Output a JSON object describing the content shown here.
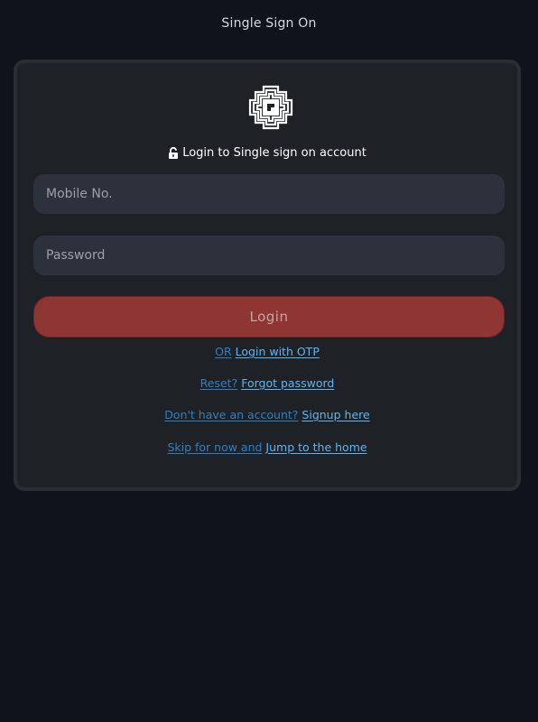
{
  "header": {
    "title": "Single Sign On"
  },
  "card": {
    "subtitle": "Login to Single sign on account",
    "mobile_placeholder": "Mobile No.",
    "password_placeholder": "Password",
    "login_label": "Login",
    "links": {
      "otp_prefix": "OR",
      "otp_label": "Login with OTP",
      "reset_prefix": "Reset?",
      "reset_label": "Forgot password",
      "signup_prefix": "Don't have an account?",
      "signup_label": "Signup here",
      "skip_prefix": "Skip for now and",
      "skip_label": "Jump to the home"
    }
  },
  "icons": {
    "logo": "brand-logo",
    "lock": "unlock-icon"
  },
  "colors": {
    "background": "#0f131b",
    "card": "#1e2227",
    "field": "#2c313b",
    "login_button": "#8f3533",
    "link": "#2e7fc2",
    "link_strong": "#5fb4f0"
  }
}
